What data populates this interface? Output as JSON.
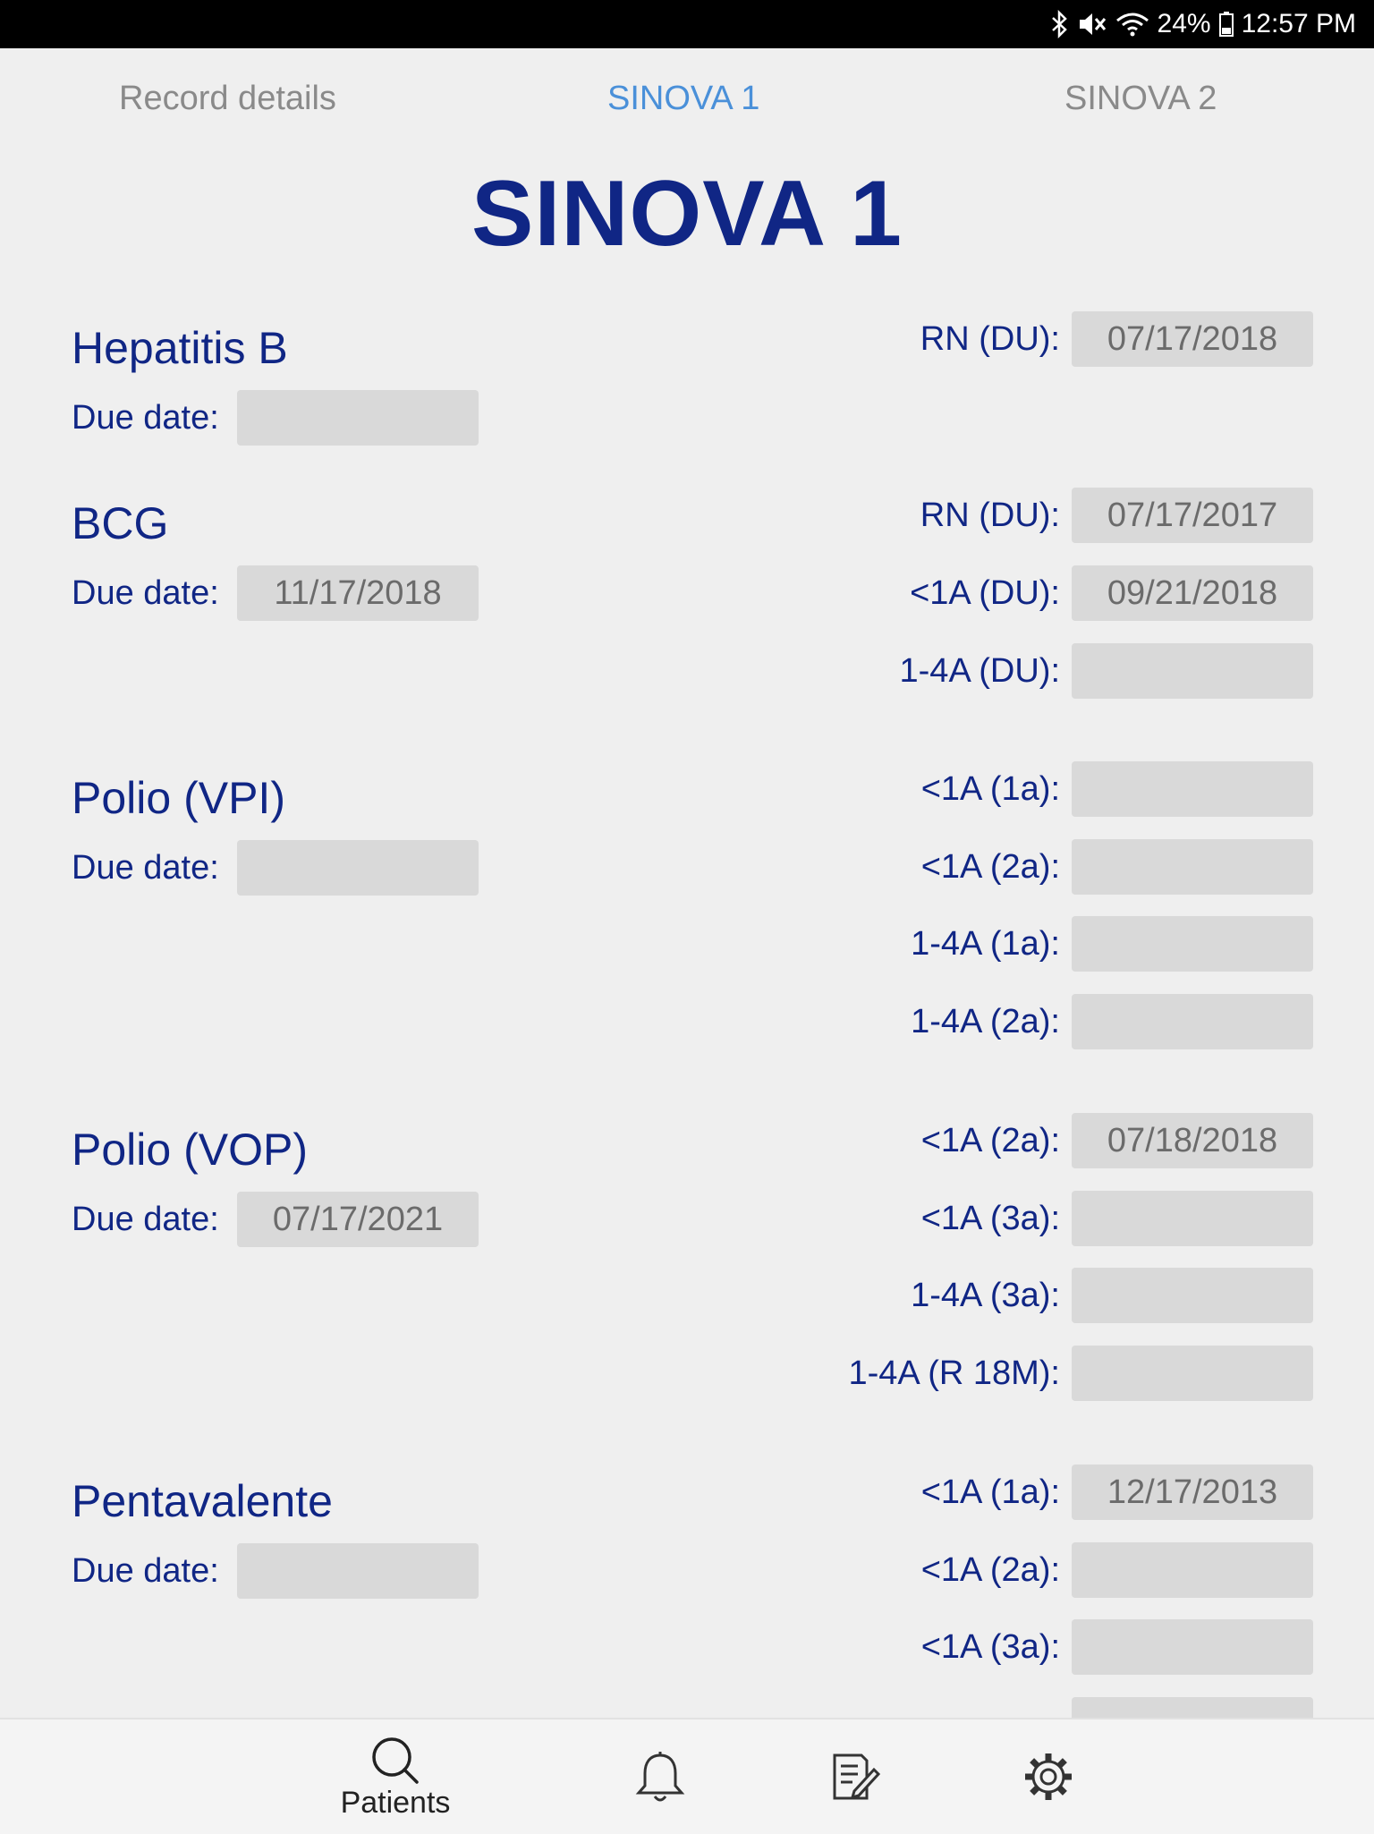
{
  "status_bar": {
    "battery": "24%",
    "time": "12:57 PM",
    "icons": [
      "bluetooth-icon",
      "mute-icon",
      "wifi-icon",
      "battery-icon"
    ]
  },
  "tabs": [
    {
      "label": "Record details",
      "active": false
    },
    {
      "label": "SINOVA 1",
      "active": true
    },
    {
      "label": "SINOVA 2",
      "active": false
    }
  ],
  "page_title": "SINOVA 1",
  "due_date_label": "Due date:",
  "vaccines": [
    {
      "name": "Hepatitis B",
      "due_date": "",
      "doses": [
        {
          "label": "RN (DU):",
          "value": "07/17/2018"
        }
      ]
    },
    {
      "name": "BCG",
      "due_date": "11/17/2018",
      "doses": [
        {
          "label": "RN (DU):",
          "value": "07/17/2017"
        },
        {
          "label": "<1A (DU):",
          "value": "09/21/2018"
        },
        {
          "label": "1-4A (DU):",
          "value": ""
        }
      ]
    },
    {
      "name": "Polio (VPI)",
      "due_date": "",
      "doses": [
        {
          "label": "<1A (1a):",
          "value": ""
        },
        {
          "label": "<1A (2a):",
          "value": ""
        },
        {
          "label": "1-4A (1a):",
          "value": ""
        },
        {
          "label": "1-4A (2a):",
          "value": ""
        }
      ]
    },
    {
      "name": "Polio (VOP)",
      "due_date": "07/17/2021",
      "doses": [
        {
          "label": "<1A (2a):",
          "value": "07/18/2018"
        },
        {
          "label": "<1A (3a):",
          "value": ""
        },
        {
          "label": "1-4A (3a):",
          "value": ""
        },
        {
          "label": "1-4A (R 18M):",
          "value": ""
        }
      ]
    },
    {
      "name": "Pentavalente",
      "due_date": "",
      "doses": [
        {
          "label": "<1A (1a):",
          "value": "12/17/2013"
        },
        {
          "label": "<1A (2a):",
          "value": ""
        },
        {
          "label": "<1A (3a):",
          "value": ""
        },
        {
          "label": "",
          "value": ""
        }
      ]
    }
  ],
  "bottom_nav": [
    {
      "label": "Patients",
      "icon": "search-icon"
    },
    {
      "label": "",
      "icon": "bell-icon"
    },
    {
      "label": "",
      "icon": "edit-document-icon"
    },
    {
      "label": "",
      "icon": "gear-icon"
    }
  ],
  "colors": {
    "title": "#102685",
    "active_tab": "#4a90d9",
    "inactive_tab": "#8a8a8a",
    "field_bg": "#d9d9d9",
    "page_bg": "#efefef"
  }
}
